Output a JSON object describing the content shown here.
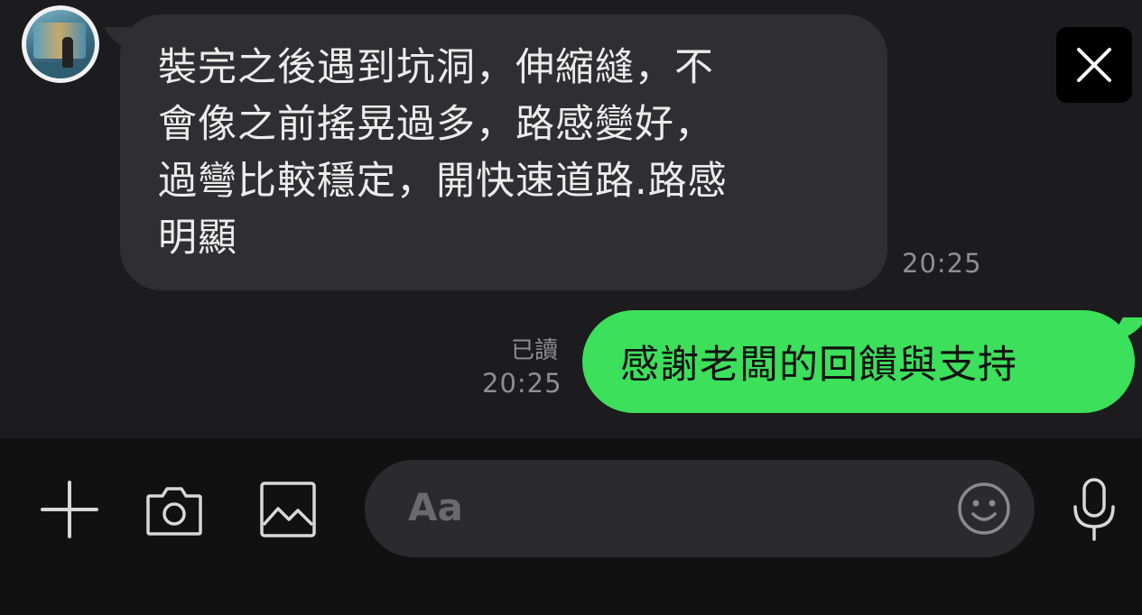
{
  "conversation": {
    "incoming": {
      "text": "裝完之後遇到坑洞，伸縮縫，不\n會像之前搖晃過多，路感變好，\n過彎比較穩定，開快速道路.路感\n明顯",
      "time": "20:25"
    },
    "outgoing": {
      "text": "感謝老闆的回饋與支持",
      "read_status": "已讀",
      "time": "20:25"
    }
  },
  "composer": {
    "placeholder": "Aa"
  },
  "icons": {
    "close": "close-icon",
    "add": "plus-icon",
    "camera": "camera-icon",
    "gallery": "image-icon",
    "emoji": "smiley-icon",
    "voice": "microphone-icon"
  },
  "colors": {
    "background": "#1c1c1e",
    "incoming_bubble": "#2f2f31",
    "outgoing_bubble": "#3ce05a",
    "toolbar": "#111111",
    "input": "#2b2b2d"
  }
}
